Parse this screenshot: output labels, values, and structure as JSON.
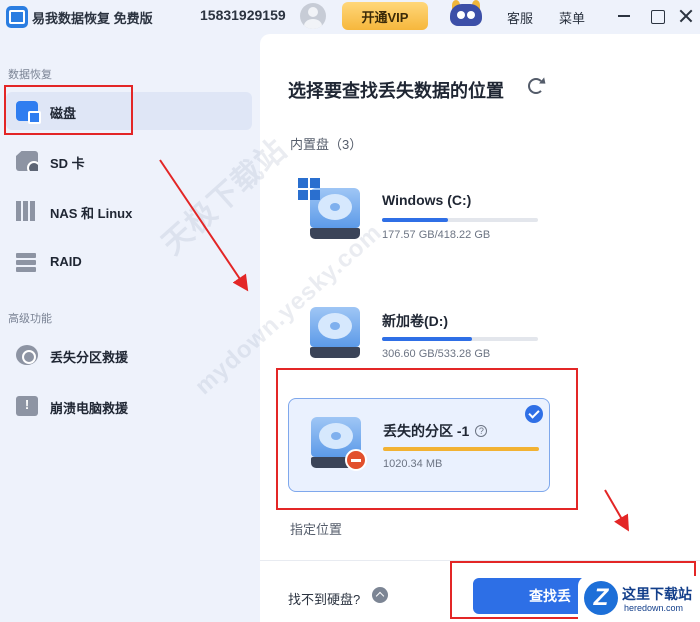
{
  "titlebar": {
    "app_name": "易我数据恢复 免费版",
    "account": "15831929159",
    "vip_button": "开通VIP",
    "service": "客服",
    "menu": "菜单"
  },
  "sidebar": {
    "section_recovery": "数据恢复",
    "section_advanced": "高级功能",
    "items": [
      {
        "label": "磁盘",
        "active": true
      },
      {
        "label": "SD 卡"
      },
      {
        "label": "NAS 和 Linux"
      },
      {
        "label": "RAID"
      },
      {
        "label": "丢失分区救援"
      },
      {
        "label": "崩溃电脑救援"
      }
    ]
  },
  "main": {
    "title": "选择要查找丢失数据的位置",
    "internal_group": "内置盘（3）",
    "specify_location": "指定位置",
    "drives": [
      {
        "name": "Windows (C:)",
        "size": "177.57 GB/418.22 GB",
        "used_fraction": 0.4246,
        "bar_color": "#2f6fe6",
        "badge": "windows-icon"
      },
      {
        "name": "新加卷(D:)",
        "size": "306.60 GB/533.28 GB",
        "used_fraction": 0.575,
        "bar_color": "#2f6fe6",
        "badge": "none"
      },
      {
        "name": "丢失的分区 -1",
        "help": "?",
        "size": "1020.34 MB",
        "used_fraction": 1.0,
        "bar_color": "#f2b233",
        "badge": "minus-icon",
        "selected": true
      }
    ]
  },
  "footer": {
    "cant_find": "找不到硬盘?",
    "scan_button": "查找丢"
  },
  "watermarks": {
    "line1": "天极下载站",
    "line2": "mydown.yesky.com"
  },
  "site_logo": {
    "mark": "Z",
    "name": "这里下载站",
    "url": "heredown.com"
  },
  "colors": {
    "accent": "#2d6fe6",
    "highlight_red": "#e32626",
    "vip_gold": "#f6b73c"
  }
}
